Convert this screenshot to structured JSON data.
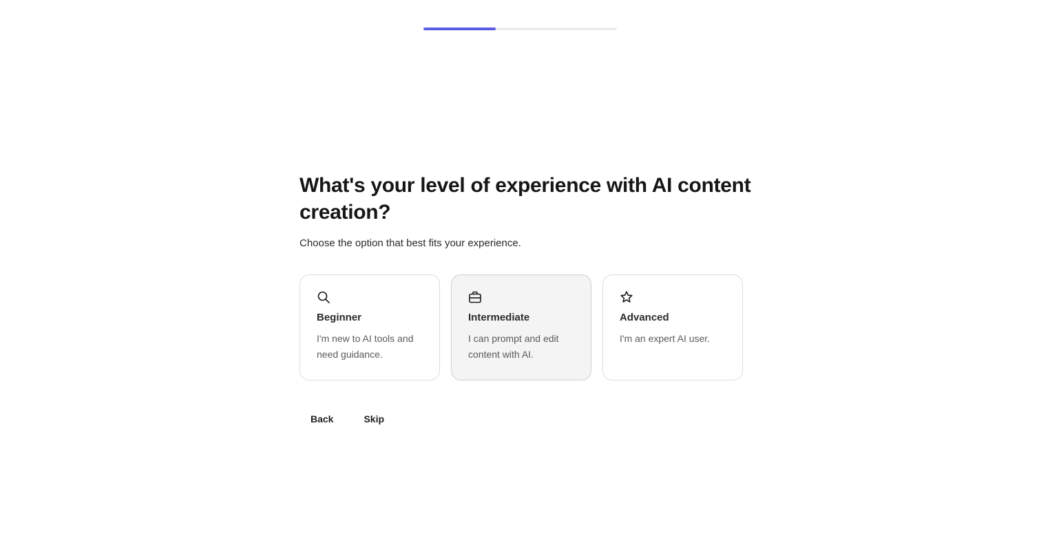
{
  "progress": {
    "fraction": 0.375,
    "color": "#5b5be6"
  },
  "question": {
    "title": "What's your level of experience with AI content creation?",
    "subtitle": "Choose the option that best fits your experience."
  },
  "options": [
    {
      "icon": "search-icon",
      "label": "Beginner",
      "description": "I'm new to AI tools and need guidance.",
      "selected": false
    },
    {
      "icon": "briefcase-icon",
      "label": "Intermediate",
      "description": "I can prompt and edit content with AI.",
      "selected": true
    },
    {
      "icon": "star-icon",
      "label": "Advanced",
      "description": "I'm an expert AI user.",
      "selected": false
    }
  ],
  "actions": {
    "back_label": "Back",
    "skip_label": "Skip"
  }
}
